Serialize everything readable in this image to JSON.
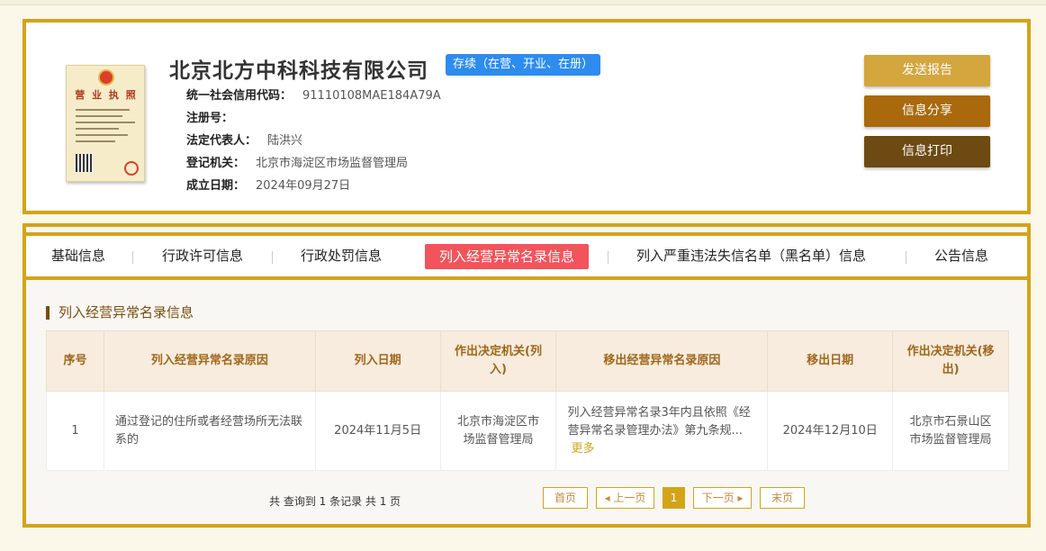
{
  "company": {
    "name": "北京北方中科科技有限公司",
    "status": "存续（在营、开业、在册）",
    "license_title": "营 业 执 照",
    "fields": [
      {
        "label": "统一社会信用代码：",
        "value": "91110108MAE184A79A"
      },
      {
        "label": "注册号：",
        "value": ""
      },
      {
        "label": "法定代表人：",
        "value": "陆洪兴"
      },
      {
        "label": "登记机关：",
        "value": "北京市海淀区市场监督管理局"
      },
      {
        "label": "成立日期：",
        "value": "2024年09月27日"
      }
    ]
  },
  "actions": {
    "send": "发送报告",
    "share": "信息分享",
    "print": "信息打印"
  },
  "tabs": [
    {
      "label": "基础信息"
    },
    {
      "label": "行政许可信息"
    },
    {
      "label": "行政处罚信息"
    },
    {
      "label": "列入经营异常名录信息"
    },
    {
      "label": "列入严重违法失信名单（黑名单）信息"
    },
    {
      "label": "公告信息"
    }
  ],
  "section_title": "列入经营异常名录信息",
  "table": {
    "headers": [
      "序号",
      "列入经营异常名录原因",
      "列入日期",
      "作出决定机关(列入)",
      "移出经营异常名录原因",
      "移出日期",
      "作出决定机关(移出)"
    ],
    "rows": [
      {
        "index": "1",
        "reason": "通过登记的住所或者经营场所无法联系的",
        "date_in": "2024年11月5日",
        "authority_in": "北京市海淀区市场监督管理局",
        "remove_reason": "列入经营异常名录3年内且依照《经营异常名录管理办法》第九条规...",
        "more": "更多",
        "date_out": "2024年12月10日",
        "authority_out": "北京市石景山区市场监督管理局"
      }
    ]
  },
  "pagination": {
    "summary": "共 查询到 1 条记录 共 1 页",
    "first": "首页",
    "prev": "◂ 上一页",
    "current": "1",
    "next": "下一页 ▸",
    "last": "末页"
  },
  "colors": {
    "frame": "#d4a418",
    "active_tab": "#f2545b",
    "status_badge": "#2d8cf0"
  }
}
